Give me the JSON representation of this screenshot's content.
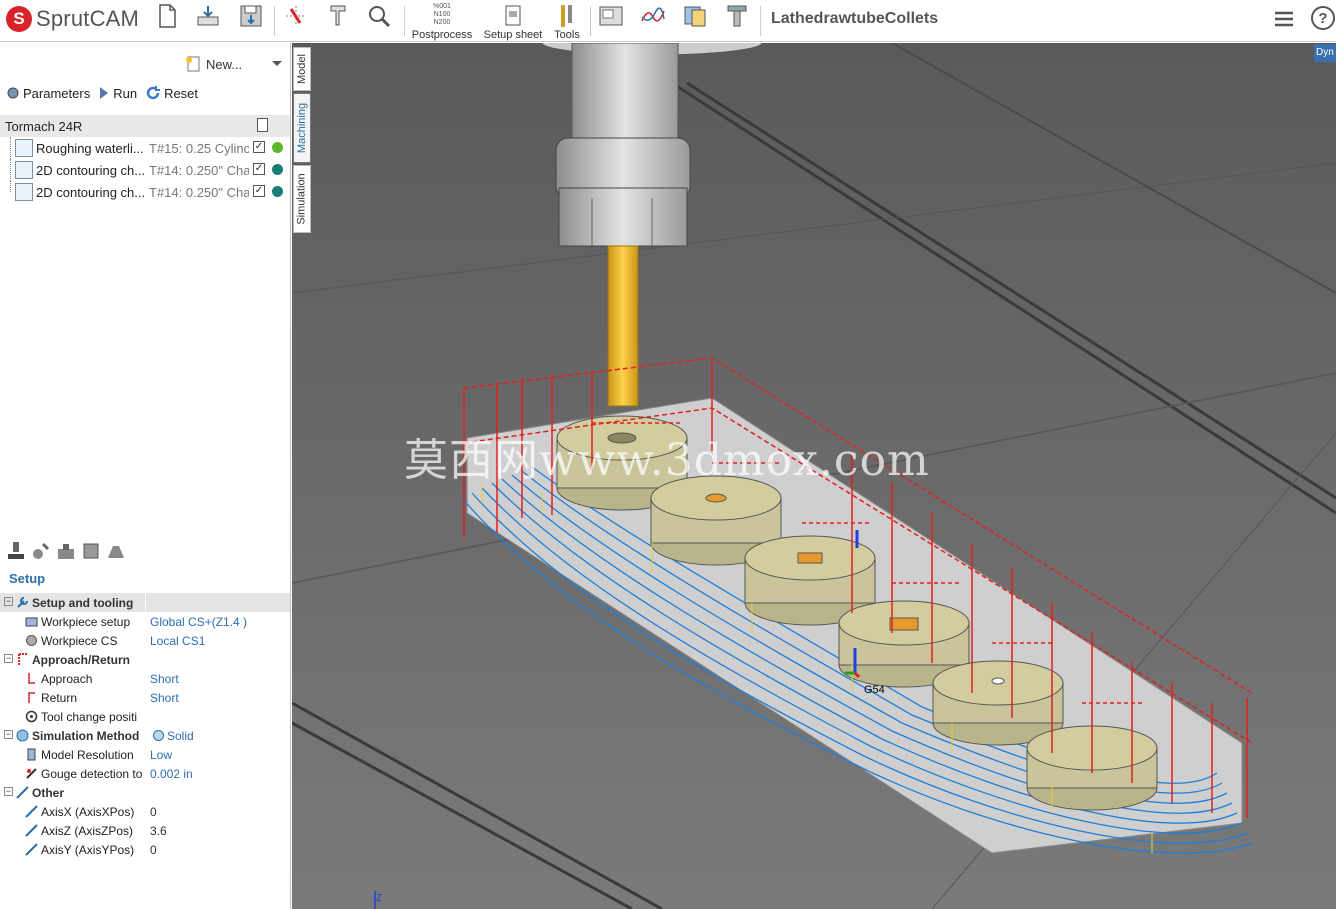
{
  "app": {
    "name": "SprutCAM",
    "logo_letter": "S",
    "project_title": "LathedrawtubeCollets"
  },
  "toolbar": {
    "postprocess_label": "Postprocess",
    "postprocess_icon_text": "%001\nN100\nN200",
    "setup_sheet_label": "Setup sheet",
    "tools_label": "Tools"
  },
  "left_panel": {
    "new_label": "New...",
    "actions": {
      "parameters": "Parameters",
      "run": "Run",
      "reset": "Reset"
    },
    "machine": "Tormach 24R",
    "operations": [
      {
        "name": "Roughing waterli...",
        "tool": "T#15: 0.25 Cylinc",
        "status_color": "#5cb82b"
      },
      {
        "name": "2D contouring ch...",
        "tool": "T#14: 0.250\" Cha",
        "status_color": "#1a7d75"
      },
      {
        "name": "2D contouring ch...",
        "tool": "T#14: 0.250\" Cha",
        "status_color": "#1a7d75"
      }
    ],
    "vertical_tabs": {
      "model": "Model",
      "machining": "Machining",
      "simulation": "Simulation"
    },
    "setup_title": "Setup",
    "properties": [
      {
        "type": "group",
        "label": "Setup and tooling"
      },
      {
        "type": "item",
        "label": "Workpiece setup",
        "value": "Global CS+(Z1.4 )"
      },
      {
        "type": "item",
        "label": "Workpiece CS",
        "value": "Local CS1"
      },
      {
        "type": "group",
        "label": "Approach/Return"
      },
      {
        "type": "item",
        "label": "Approach",
        "value": "Short"
      },
      {
        "type": "item",
        "label": "Return",
        "value": "Short"
      },
      {
        "type": "item",
        "label": "Tool change positi",
        "value": ""
      },
      {
        "type": "group",
        "label": "Simulation Method",
        "value": "Solid"
      },
      {
        "type": "item",
        "label": "Model Resolution",
        "value": "Low"
      },
      {
        "type": "item",
        "label": "Gouge detection to",
        "value": "0.002 in"
      },
      {
        "type": "group",
        "label": "Other"
      },
      {
        "type": "item",
        "label": "AxisX (AxisXPos)",
        "value": "0"
      },
      {
        "type": "item",
        "label": "AxisZ (AxisZPos)",
        "value": "3.6"
      },
      {
        "type": "item",
        "label": "AxisY (AxisYPos)",
        "value": "0"
      }
    ]
  },
  "viewport": {
    "view_mode_tag": "Dyn",
    "coord_label": "G54",
    "axis_label": "Z",
    "watermark": "莫西网www.3dmox.com"
  },
  "colors": {
    "accent": "#2c6fa6",
    "value_blue": "#2e6db4",
    "toolpath_red": "#e02020",
    "toolpath_blue": "#1e7fd8",
    "tool_yellow": "#f5c02c"
  }
}
